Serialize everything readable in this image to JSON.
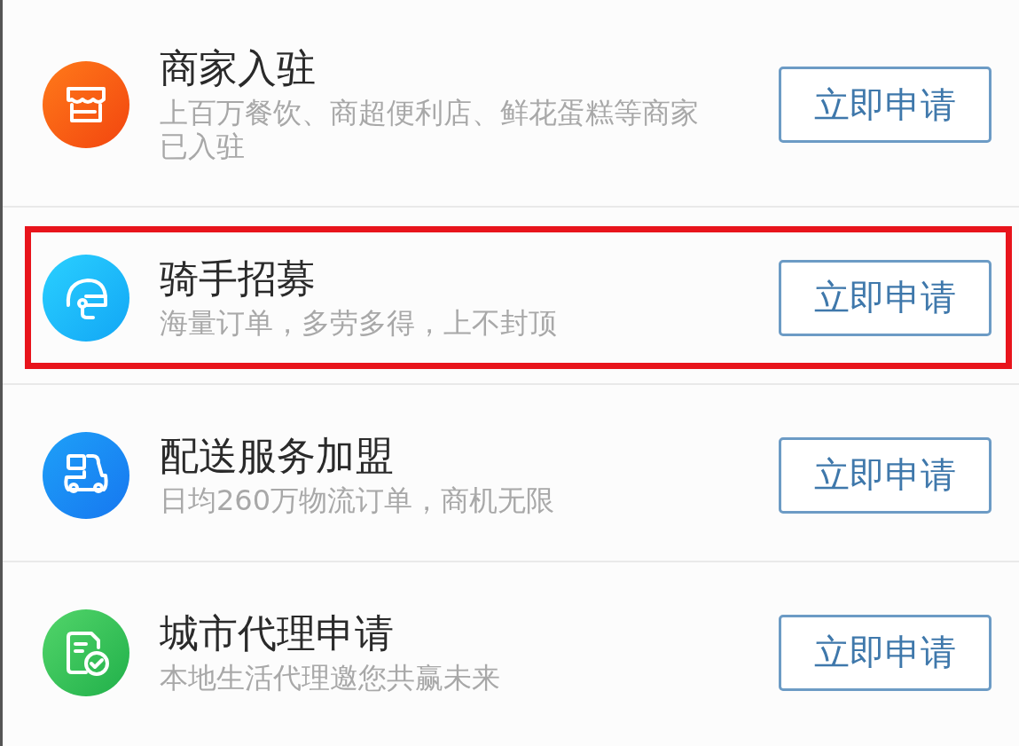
{
  "items": [
    {
      "kind": "store",
      "title": "商家入驻",
      "subtitle": "上百万餐饮、商超便利店、鲜花蛋糕等商家已入驻",
      "button": "立即申请",
      "highlighted": false
    },
    {
      "kind": "helmet",
      "title": "骑手招募",
      "subtitle": "海量订单，多劳多得，上不封顶",
      "button": "立即申请",
      "highlighted": true
    },
    {
      "kind": "scooter",
      "title": "配送服务加盟",
      "subtitle": "日均260万物流订单，商机无限",
      "button": "立即申请",
      "highlighted": false
    },
    {
      "kind": "document",
      "title": "城市代理申请",
      "subtitle": "本地生活代理邀您共赢未来",
      "button": "立即申请",
      "highlighted": false
    }
  ]
}
